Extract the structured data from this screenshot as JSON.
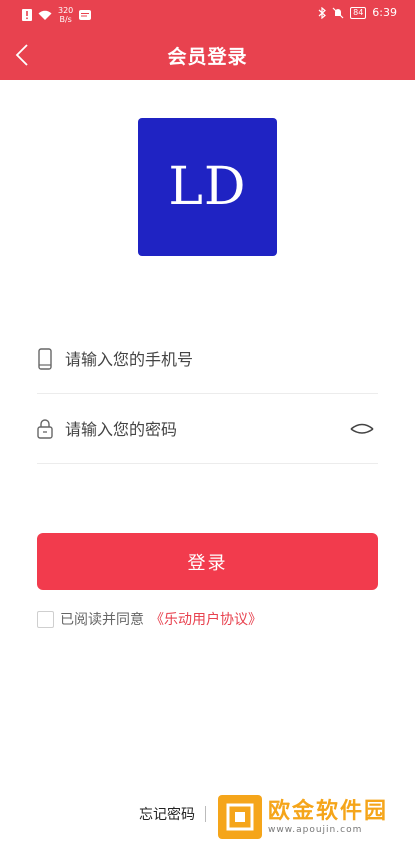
{
  "status_bar": {
    "net_speed_top": "320",
    "net_speed_bottom": "B/s",
    "battery": "84",
    "time": "6:39",
    "bg_color": "#e8424f"
  },
  "header": {
    "title": "会员登录",
    "back_icon": "chevron-left-icon"
  },
  "logo": {
    "text": "LD",
    "bg_color": "#1f23c3"
  },
  "form": {
    "phone_placeholder": "请输入您的手机号",
    "password_placeholder": "请输入您的密码",
    "phone_icon": "phone-icon",
    "lock_icon": "lock-icon",
    "eye_icon": "eye-closed-icon"
  },
  "login_button": {
    "label": "登录",
    "color": "#f23b4d"
  },
  "agreement": {
    "text": "已阅读并同意",
    "link": "《乐动用户协议》"
  },
  "bottom": {
    "forgot_password": "忘记密码"
  },
  "watermark": {
    "title": "欧金软件园",
    "url": "www.apoujin.com",
    "color": "#f5a51a"
  }
}
